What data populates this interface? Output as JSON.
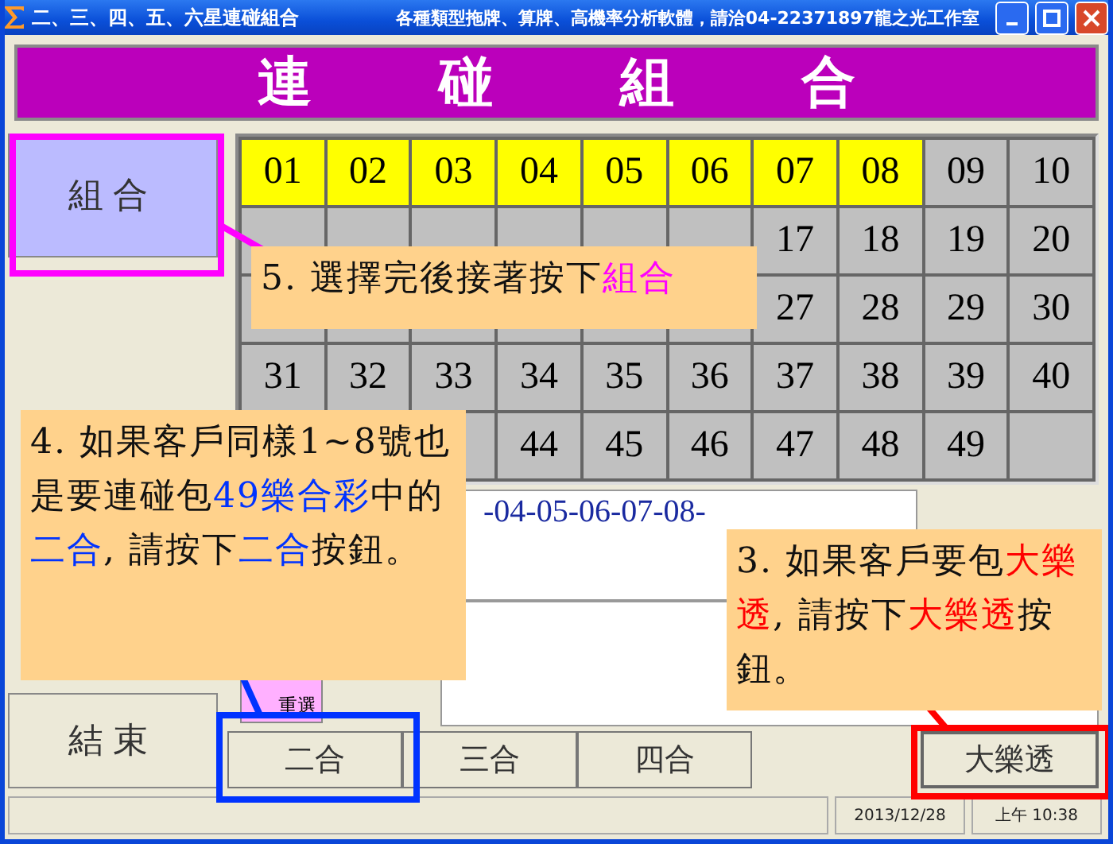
{
  "window": {
    "title": "二、三、四、五、六星連碰組合",
    "tagline": "各種類型拖牌、算牌、高機率分析軟體，請洽04-22371897龍之光工作室"
  },
  "banner": "連碰組合",
  "side_buttons": [
    {
      "label": "組合",
      "kind": "primary"
    },
    {
      "label": "結束",
      "kind": "plain"
    }
  ],
  "grid": [
    {
      "cells": [
        {
          "number": "01",
          "selected": true
        },
        {
          "number": "02",
          "selected": true
        },
        {
          "number": "03",
          "selected": true
        },
        {
          "number": "04",
          "selected": true
        },
        {
          "number": "05",
          "selected": true
        },
        {
          "number": "06",
          "selected": true
        },
        {
          "number": "07",
          "selected": true
        },
        {
          "number": "08",
          "selected": true
        },
        {
          "number": "09",
          "selected": false
        },
        {
          "number": "10",
          "selected": false
        }
      ]
    },
    {
      "cells": [
        {
          "selected": false
        },
        {
          "selected": false
        },
        {
          "selected": false
        },
        {
          "selected": false
        },
        {
          "selected": false
        },
        {
          "selected": false
        },
        {
          "number": "17",
          "selected": false
        },
        {
          "number": "18",
          "selected": false
        },
        {
          "number": "19",
          "selected": false
        },
        {
          "number": "20",
          "selected": false
        }
      ]
    },
    {
      "cells": [
        {
          "selected": false
        },
        {
          "selected": false
        },
        {
          "selected": false
        },
        {
          "selected": false
        },
        {
          "selected": false
        },
        {
          "selected": false
        },
        {
          "number": "27",
          "selected": false
        },
        {
          "number": "28",
          "selected": false
        },
        {
          "number": "29",
          "selected": false
        },
        {
          "number": "30",
          "selected": false
        }
      ]
    },
    {
      "cells": [
        {
          "number": "31",
          "selected": false
        },
        {
          "number": "32",
          "selected": false
        },
        {
          "number": "33",
          "selected": false
        },
        {
          "number": "34",
          "selected": false
        },
        {
          "number": "35",
          "selected": false
        },
        {
          "number": "36",
          "selected": false
        },
        {
          "number": "37",
          "selected": false
        },
        {
          "number": "38",
          "selected": false
        },
        {
          "number": "39",
          "selected": false
        },
        {
          "number": "40",
          "selected": false
        }
      ]
    },
    {
      "cells": [
        {
          "selected": false
        },
        {
          "number": "44",
          "selected": false
        },
        {
          "number": "45",
          "selected": false
        },
        {
          "number": "46",
          "selected": false
        },
        {
          "number": "47",
          "selected": false
        },
        {
          "number": "48",
          "selected": false
        },
        {
          "number": "49",
          "selected": false
        },
        {
          "selected": false
        }
      ]
    }
  ],
  "result_text": "-04-05-06-07-08-",
  "reselect_button": "重選",
  "combo_buttons": [
    "二合",
    "三合",
    "四合"
  ],
  "lotto_button": "大樂透",
  "status_bar": {
    "date": "2013/12/28",
    "time": "上午 10:38"
  },
  "callouts": [
    {
      "color": "#ff00ff",
      "segments": [
        {
          "text": "5. 選擇完後接著按下",
          "emphasis": false
        },
        {
          "text": "組合",
          "emphasis": true
        }
      ]
    },
    {
      "color": "#0033ff",
      "segments": [
        {
          "text": "4. 如果客戶同樣1~8號也是要連碰包",
          "emphasis": false
        },
        {
          "text": "49樂合彩",
          "emphasis": true
        },
        {
          "text": "中的",
          "emphasis": false
        },
        {
          "text": "二合",
          "emphasis": true
        },
        {
          "text": ", 請按下",
          "emphasis": false
        },
        {
          "text": "二合",
          "emphasis": true
        },
        {
          "text": "按鈕。",
          "emphasis": false
        }
      ]
    },
    {
      "color": "#ff0000",
      "segments": [
        {
          "text": "3. 如果客戶要包",
          "emphasis": false
        },
        {
          "text": "大樂透",
          "emphasis": true
        },
        {
          "text": ", 請按下",
          "emphasis": false
        },
        {
          "text": "大樂透",
          "emphasis": true
        },
        {
          "text": "按鈕。",
          "emphasis": false
        }
      ]
    }
  ]
}
